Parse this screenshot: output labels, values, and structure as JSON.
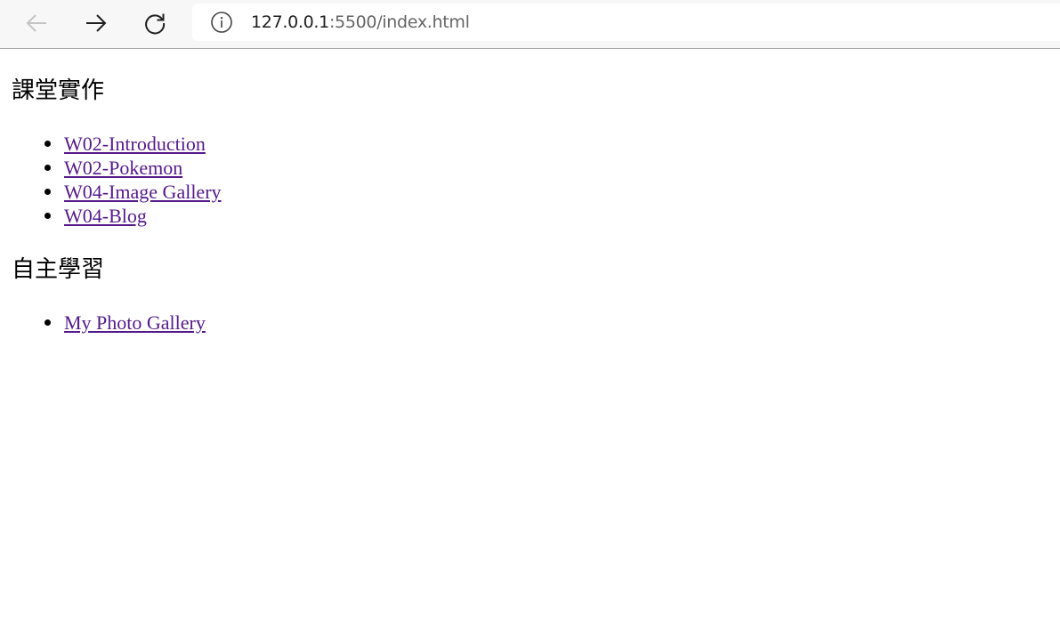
{
  "browser": {
    "url_host": "127.0.0.1",
    "url_rest": ":5500/index.html",
    "icons": {
      "back": "arrow-left-icon",
      "forward": "arrow-right-icon",
      "reload": "reload-icon",
      "info": "info-icon"
    }
  },
  "page": {
    "sections": [
      {
        "heading": "課堂實作",
        "links": [
          {
            "label": "W02-Introduction"
          },
          {
            "label": "W02-Pokemon"
          },
          {
            "label": "W04-Image Gallery"
          },
          {
            "label": "W04-Blog"
          }
        ]
      },
      {
        "heading": "自主學習",
        "links": [
          {
            "label": "My Photo Gallery"
          }
        ]
      }
    ],
    "colors": {
      "visited_link": "#551a8b",
      "toolbar_bg": "#f7f7f7",
      "url_muted": "#666666"
    }
  }
}
